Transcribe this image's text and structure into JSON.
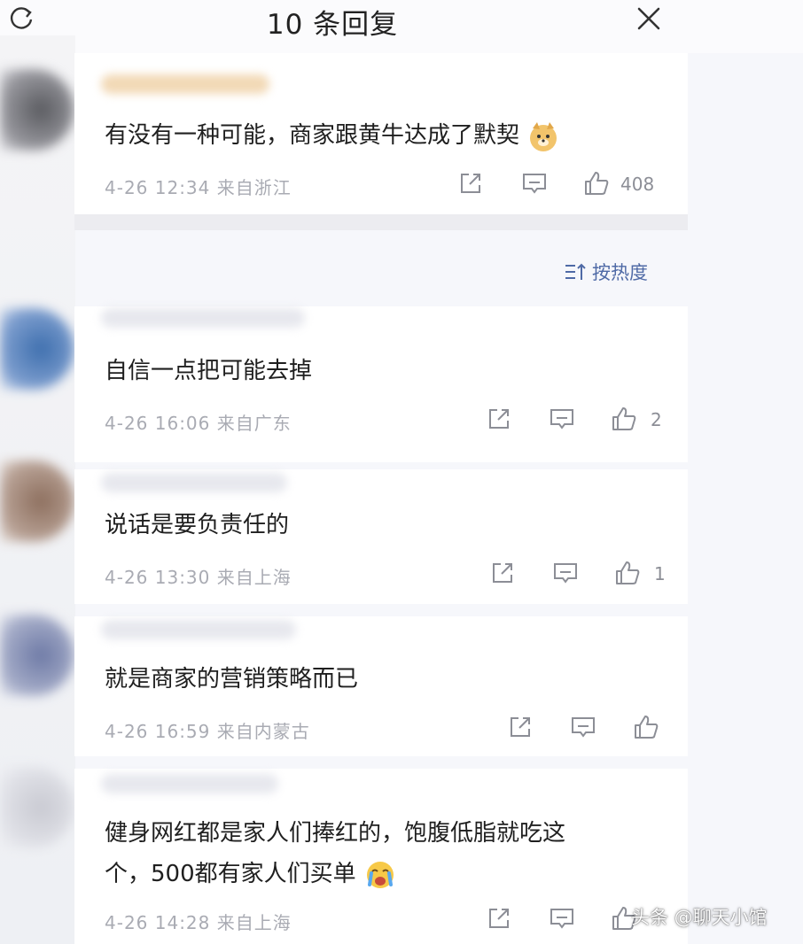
{
  "header": {
    "title": "10 条回复"
  },
  "comments": [
    {
      "text": "有没有一种可能，商家跟黄牛达成了默契",
      "meta": "4-26 12:34 来自浙江",
      "likes": "408"
    },
    {
      "text": "自信一点把可能去掉",
      "meta": "4-26 16:06 来自广东",
      "likes": "2"
    },
    {
      "text": "说话是要负责任的",
      "meta": "4-26 13:30 来自上海",
      "likes": "1"
    },
    {
      "text": "就是商家的营销策略而已",
      "meta": "4-26 16:59 来自内蒙古",
      "likes": ""
    },
    {
      "text_line1": "健身网红都是家人们捧红的，饱腹低脂就吃这",
      "text_line2": "个，500都有家人们买单",
      "meta": "4-26 14:28 来自上海",
      "likes": ""
    }
  ],
  "sort": {
    "label": "按热度"
  },
  "watermark": "头条 @聊天小馆",
  "colors": {
    "accent": "#4f6aa6",
    "meta": "#a9abb3",
    "background": "#f6f7fb"
  },
  "icons": [
    "refresh-icon",
    "close-icon",
    "share-icon",
    "reply-icon",
    "like-icon",
    "sort-icon",
    "doge-emoji",
    "crying-emoji"
  ]
}
